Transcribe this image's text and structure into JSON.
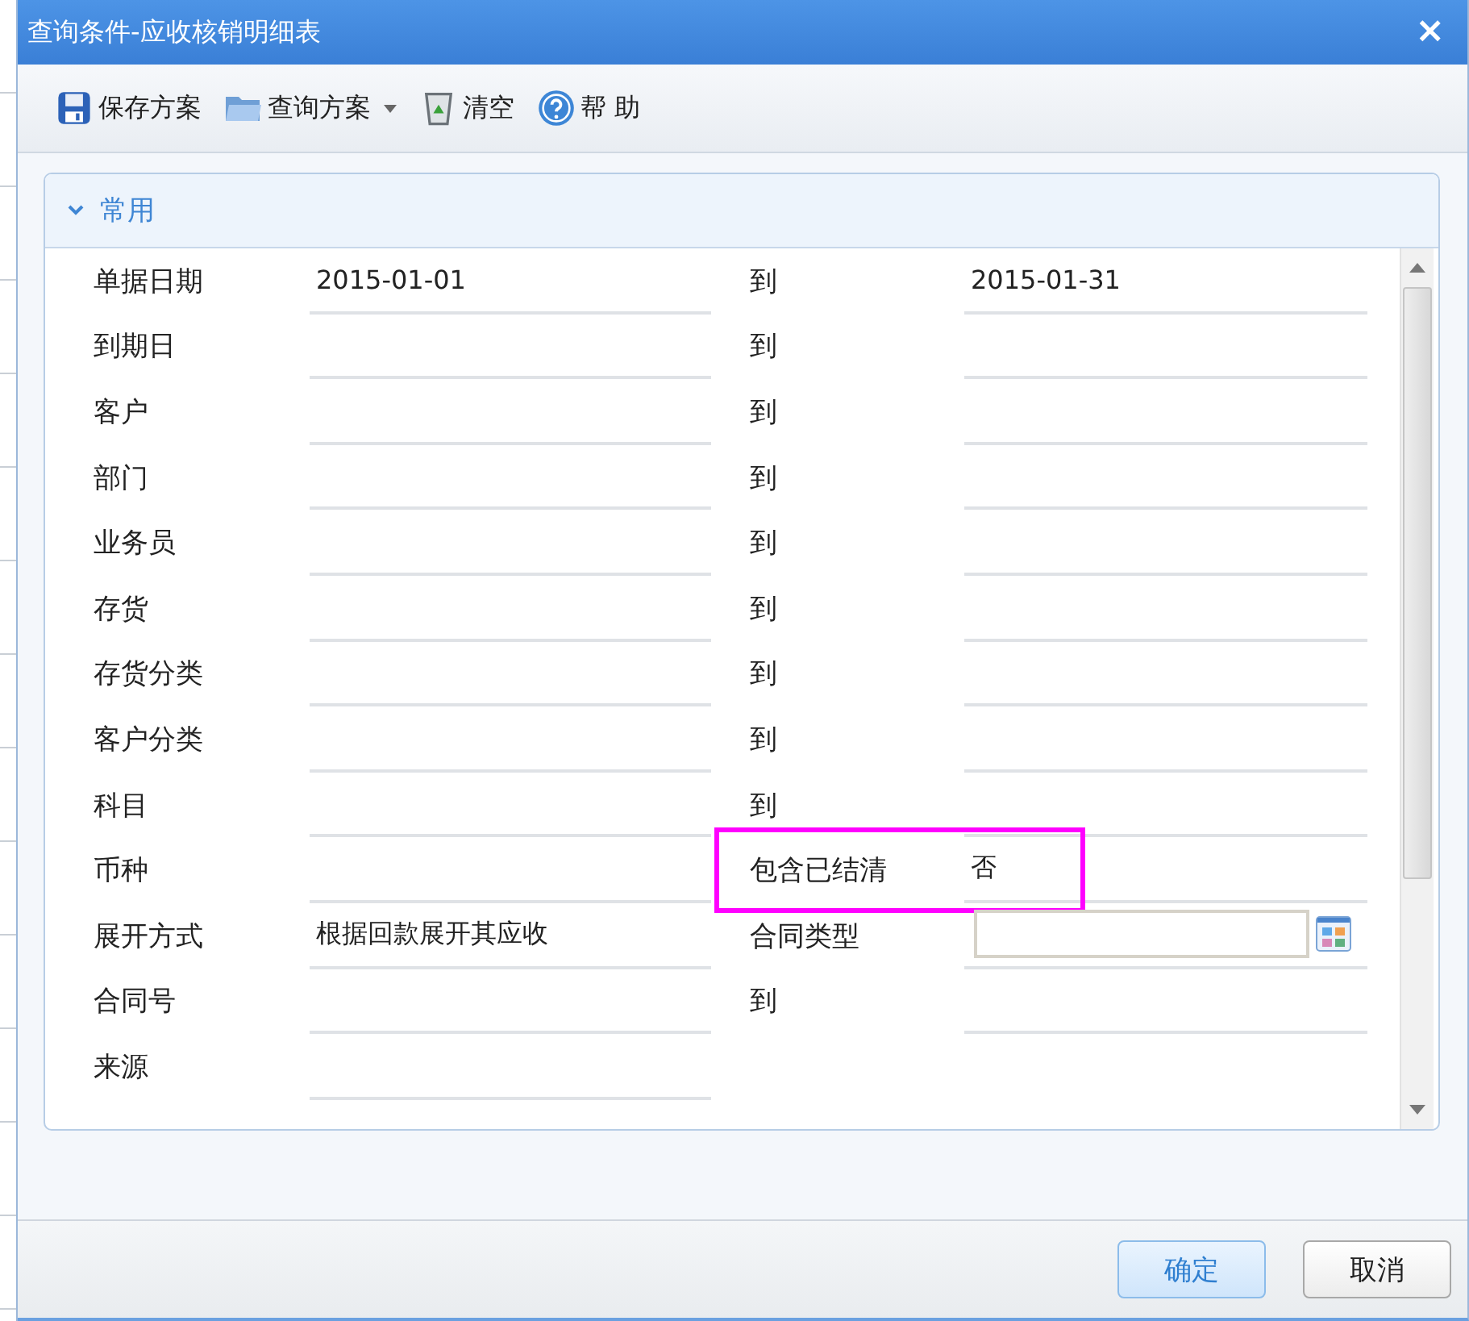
{
  "window": {
    "title": "查询条件-应收核销明细表",
    "close": "×"
  },
  "toolbar": [
    {
      "label": "保存方案"
    },
    {
      "label": "查询方案",
      "dropdown": true
    },
    {
      "label": "清空"
    },
    {
      "label": "帮 助"
    }
  ],
  "section": {
    "title": "常用",
    "expanded": true
  },
  "rows": [
    {
      "label": "单据日期",
      "value": "2015-01-01",
      "right": {
        "kind": "range",
        "label": "到",
        "value": "2015-01-31"
      }
    },
    {
      "label": "到期日",
      "right": {
        "kind": "range",
        "label": "到"
      }
    },
    {
      "label": "客户",
      "right": {
        "kind": "range",
        "label": "到"
      }
    },
    {
      "label": "部门",
      "right": {
        "kind": "range",
        "label": "到"
      }
    },
    {
      "label": "业务员",
      "right": {
        "kind": "range",
        "label": "到"
      }
    },
    {
      "label": "存货",
      "right": {
        "kind": "range",
        "label": "到"
      }
    },
    {
      "label": "存货分类",
      "right": {
        "kind": "range",
        "label": "到"
      }
    },
    {
      "label": "客户分类",
      "right": {
        "kind": "range",
        "label": "到"
      }
    },
    {
      "label": "科目",
      "right": {
        "kind": "range",
        "label": "到"
      }
    },
    {
      "label": "币种",
      "right": {
        "kind": "field",
        "label": "包含已结清",
        "value": "否",
        "highlighted": true
      }
    },
    {
      "label": "展开方式",
      "value": "根据回款展开其应收",
      "right": {
        "kind": "combo",
        "label": "合同类型"
      }
    },
    {
      "label": "合同号",
      "right": {
        "kind": "range",
        "label": "到"
      }
    },
    {
      "label": "来源"
    }
  ],
  "buttons": [
    {
      "label": "确定",
      "primary": true
    },
    {
      "label": "取消",
      "primary": false
    }
  ]
}
